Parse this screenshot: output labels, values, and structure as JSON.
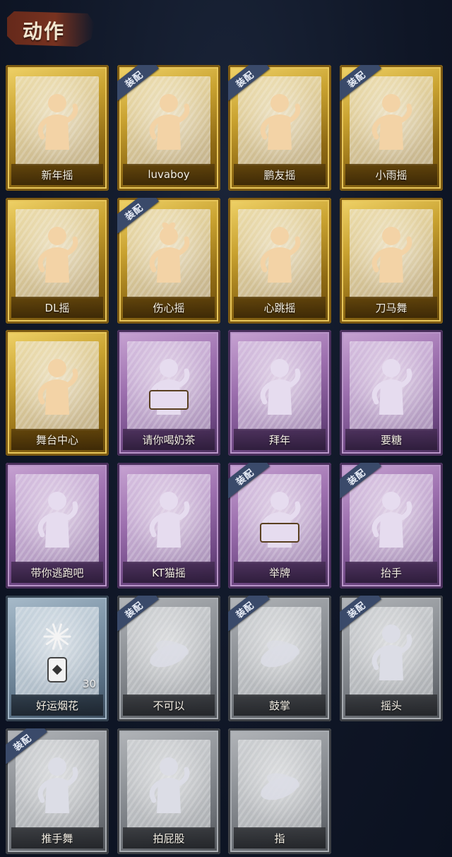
{
  "section_title": "动作",
  "equipped_badge": "装配",
  "colors": {
    "gold": "#c9a230",
    "purple": "#9c6fae",
    "blue": "#7c93a6",
    "gray": "#8e9297",
    "background": "#0f1626"
  },
  "items": [
    {
      "label": "新年摇",
      "rarity": "gold",
      "equipped": false,
      "icon": "dance-figure-icon"
    },
    {
      "label": "luvaboy",
      "rarity": "gold",
      "equipped": true,
      "icon": "dance-figure-icon"
    },
    {
      "label": "鹏友摇",
      "rarity": "gold",
      "equipped": true,
      "icon": "dance-figure-icon"
    },
    {
      "label": "小雨摇",
      "rarity": "gold",
      "equipped": true,
      "icon": "dance-figure-icon"
    },
    {
      "label": "DL摇",
      "rarity": "gold",
      "equipped": false,
      "icon": "dance-figure-icon"
    },
    {
      "label": "伤心摇",
      "rarity": "gold",
      "equipped": true,
      "icon": "heart-hands-figure-icon"
    },
    {
      "label": "心跳摇",
      "rarity": "gold",
      "equipped": false,
      "icon": "dance-figure-icon"
    },
    {
      "label": "刀马舞",
      "rarity": "gold",
      "equipped": false,
      "icon": "dance-figure-icon"
    },
    {
      "label": "舞台中心",
      "rarity": "gold",
      "equipped": false,
      "icon": "dance-figure-icon"
    },
    {
      "label": "请你喝奶茶",
      "rarity": "purple",
      "equipped": false,
      "icon": "sign-holding-figure-icon"
    },
    {
      "label": "拜年",
      "rarity": "purple",
      "equipped": false,
      "icon": "bowing-figure-icon"
    },
    {
      "label": "要糖",
      "rarity": "purple",
      "equipped": false,
      "icon": "reaching-figure-icon"
    },
    {
      "label": "带你逃跑吧",
      "rarity": "purple",
      "equipped": false,
      "icon": "pointing-figure-icon"
    },
    {
      "label": "KT猫摇",
      "rarity": "purple",
      "equipped": false,
      "icon": "dance-figure-icon"
    },
    {
      "label": "举牌",
      "rarity": "purple",
      "equipped": true,
      "icon": "sign-holding-figure-icon"
    },
    {
      "label": "抬手",
      "rarity": "purple",
      "equipped": true,
      "icon": "raise-hand-figure-icon"
    },
    {
      "label": "好运烟花",
      "rarity": "blue",
      "equipped": false,
      "icon": "firework-can-icon",
      "count": "30"
    },
    {
      "label": "不可以",
      "rarity": "gray",
      "equipped": true,
      "icon": "finger-wag-icon"
    },
    {
      "label": "鼓掌",
      "rarity": "gray",
      "equipped": true,
      "icon": "clapping-hands-icon"
    },
    {
      "label": "摇头",
      "rarity": "gray",
      "equipped": true,
      "icon": "head-shake-figure-icon"
    },
    {
      "label": "推手舞",
      "rarity": "gray",
      "equipped": true,
      "icon": "push-dance-figure-icon"
    },
    {
      "label": "拍屁股",
      "rarity": "gray",
      "equipped": false,
      "icon": "slap-figure-icon"
    },
    {
      "label": "指",
      "rarity": "gray",
      "equipped": false,
      "icon": "pointing-hand-icon"
    }
  ]
}
